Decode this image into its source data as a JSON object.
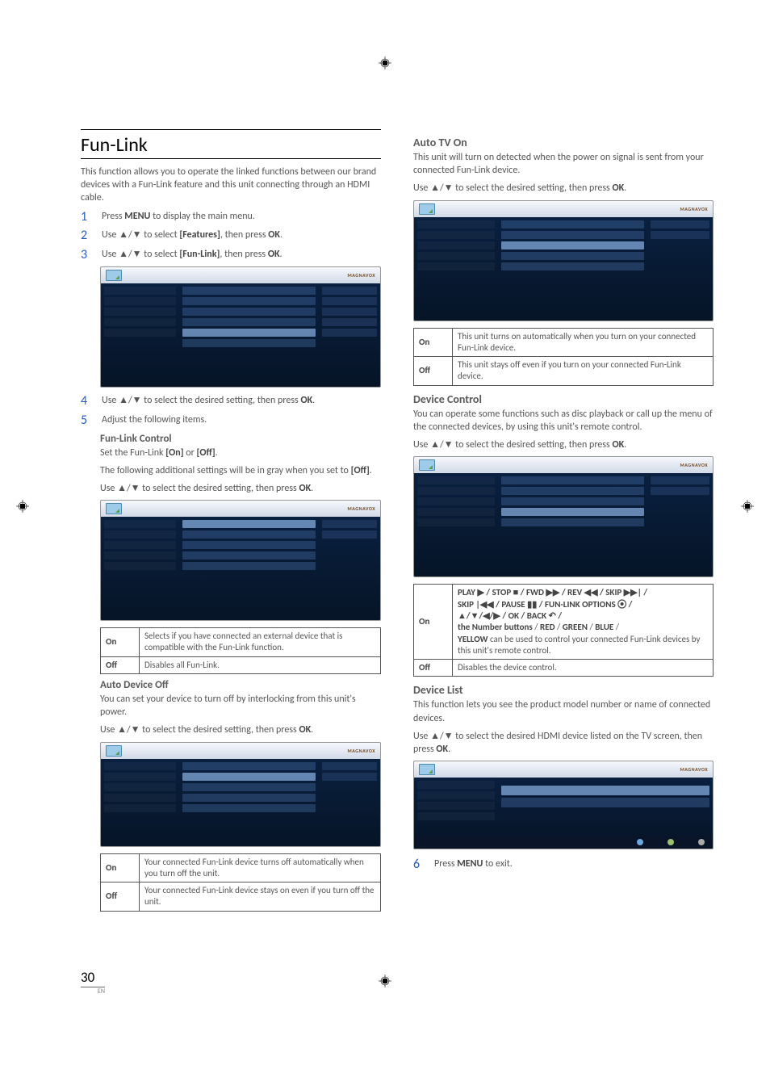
{
  "printMarkBrand": "MAGNAVOX",
  "section": {
    "title": "Fun-Link",
    "intro": "This function allows you to operate the linked functions between our brand devices with a Fun-Link feature and this unit connecting through an HDMI cable."
  },
  "steps": {
    "s1": {
      "num": "1",
      "text_a": "Press ",
      "b1": "MENU",
      "text_b": " to display the main menu."
    },
    "s2": {
      "num": "2",
      "text_a": "Use ▲/▼ to select ",
      "b1": "[Features]",
      "text_b": ", then press ",
      "b2": "OK",
      "text_c": "."
    },
    "s3": {
      "num": "3",
      "text_a": "Use ▲/▼ to select ",
      "b1": "[Fun-Link]",
      "text_b": ", then press ",
      "b2": "OK",
      "text_c": "."
    },
    "s4": {
      "num": "4",
      "text_a": "Use ▲/▼ to select the desired setting, then press ",
      "b1": "OK",
      "text_b": "."
    },
    "s5": {
      "num": "5",
      "text_a": "Adjust the following items."
    },
    "s6": {
      "num": "6",
      "text_a": "Press ",
      "b1": "MENU",
      "text_b": " to exit."
    }
  },
  "funlinkControl": {
    "heading": "Fun-Link Control",
    "line1_a": "Set the Fun-Link ",
    "line1_b1": "[On]",
    "line1_mid": " or ",
    "line1_b2": "[Off]",
    "line1_end": ".",
    "line2_a": "The following additional settings will be in gray when you set to ",
    "line2_b": "[Off]",
    "line2_end": ".",
    "line3_a": "Use ▲/▼ to select the desired setting, then press ",
    "line3_b": "OK",
    "line3_end": ".",
    "opts": {
      "on": {
        "label": "On",
        "desc": "Selects if you have connected an external device that is compatible with the Fun-Link function."
      },
      "off": {
        "label": "Off",
        "desc": "Disables all Fun-Link."
      }
    }
  },
  "autoDeviceOff": {
    "heading": "Auto Device Off",
    "line1": "You can set your device to turn off by interlocking from this unit's power.",
    "line2_a": "Use ▲/▼ to select the desired setting, then press ",
    "line2_b": "OK",
    "line2_end": ".",
    "opts": {
      "on": {
        "label": "On",
        "desc": "Your connected Fun-Link device turns off automatically when you turn off the unit."
      },
      "off": {
        "label": "Off",
        "desc": "Your connected Fun-Link device stays on even if you turn off the unit."
      }
    }
  },
  "autoTvOn": {
    "heading": "Auto TV On",
    "line1": "This unit will turn on detected when the power on signal is sent from your connected Fun-Link device.",
    "line2_a": "Use ▲/▼ to select the desired setting, then press ",
    "line2_b": "OK",
    "line2_end": ".",
    "opts": {
      "on": {
        "label": "On",
        "desc": "This unit turns on automatically when you turn on your connected Fun-Link device."
      },
      "off": {
        "label": "Off",
        "desc": "This unit stays off even if you turn on your connected Fun-Link device."
      }
    }
  },
  "deviceControl": {
    "heading": "Device Control",
    "line1": "You can operate some functions such as disc playback or call up the menu of the connected devices, by using this unit's remote control.",
    "line2_a": "Use ▲/▼ to select the desired setting, then press ",
    "line2_b": "OK",
    "line2_end": ".",
    "opts": {
      "on": {
        "label": "On",
        "l1": "PLAY ▶ / STOP ■ / FWD ▶▶ / REV ◀◀ / SKIP ▶▶| /",
        "l2": "SKIP |◀◀ / PAUSE ▮▮ / FUN-LINK OPTIONS ⦿⃝ /",
        "l3": "▲/▼/◀/▶ / OK / BACK ↶ /",
        "l4a": "the Number buttons",
        "l4b": " / ",
        "l4c": "RED",
        "l4d": " / ",
        "l4e": "GREEN",
        "l4f": " / ",
        "l4g": "BLUE",
        "l4h": " /",
        "l5a": "YELLOW",
        "l5b": " can be used to control your connected Fun-Link devices by this unit's remote control."
      },
      "off": {
        "label": "Off",
        "desc": "Disables the device control."
      }
    }
  },
  "deviceList": {
    "heading": "Device List",
    "line1": "This function lets you see the product model number or name of connected devices.",
    "line2_a": "Use ▲/▼ to select the desired HDMI device listed on the TV screen, then press ",
    "line2_b": "OK",
    "line2_end": "."
  },
  "footer": {
    "pageNum": "30",
    "lang": "EN"
  }
}
